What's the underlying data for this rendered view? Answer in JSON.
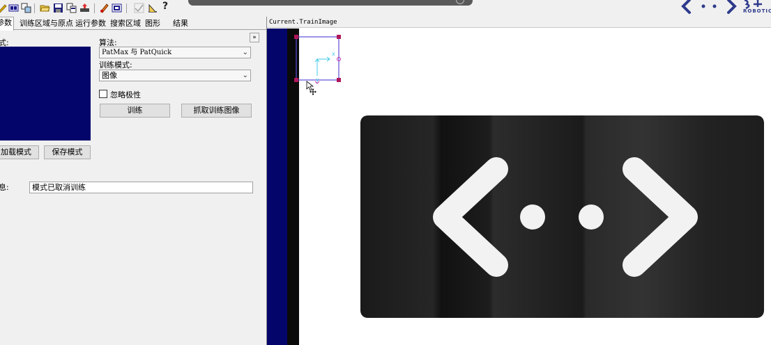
{
  "toolbar": {
    "icons": [
      "new-icon",
      "train-region-icon",
      "copy-region-icon",
      "open-icon",
      "save-icon",
      "copy-icon",
      "import-icon",
      "edit-icon",
      "image-icon",
      "check-icon",
      "measure-icon",
      "help-icon"
    ],
    "help_glyph": "?"
  },
  "tabs": [
    {
      "label": "参数",
      "active": true
    },
    {
      "label": "训练区域与原点",
      "active": false
    },
    {
      "label": "运行参数",
      "active": false
    },
    {
      "label": "搜索区域",
      "active": false
    },
    {
      "label": "图形",
      "active": false
    },
    {
      "label": "结果",
      "active": false
    }
  ],
  "panel": {
    "pattern_label": "式:",
    "collapse_glyph": "»",
    "algorithm_label": "算法:",
    "algorithm_value": "PatMax 与 PatQuick",
    "train_mode_label": "训练模式:",
    "train_mode_value": "图像",
    "ignore_polarity_label": "忽略极性",
    "ignore_polarity_checked": false,
    "train_button": "训练",
    "grab_train_image_button": "抓取训练图像",
    "load_pattern_button": "加载模式",
    "save_pattern_button": "保存模式",
    "message_label": "息:",
    "message_value": "模式已取消训练"
  },
  "viewer": {
    "title": "Current.TrainImage"
  },
  "logo": {
    "text": "ROBOTIC"
  },
  "colors": {
    "pattern_bg": "#04056a",
    "roi_border": "#5a4ed8",
    "handle": "#b0175a",
    "origin_axes": "#40c8e8"
  }
}
